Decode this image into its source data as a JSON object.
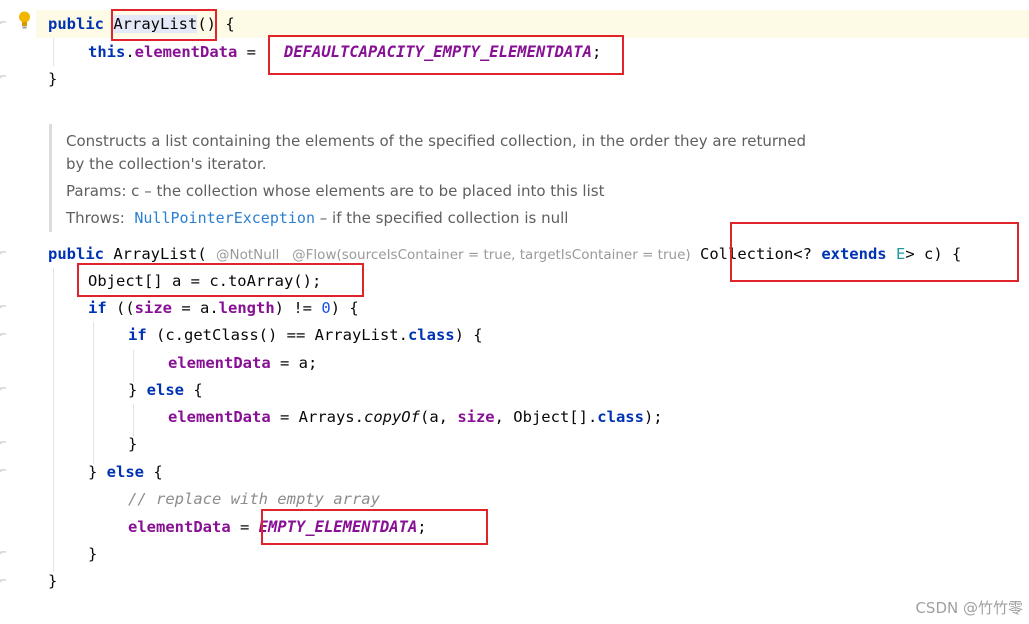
{
  "code": {
    "ctor1": {
      "kw_public": "public",
      "name": "ArrayList",
      "tail": "() {",
      "this_kw": "this",
      "dot": ".",
      "field": "elementData",
      "eq": " = ",
      "value": "DEFAULTCAPACITY_EMPTY_ELEMENTDATA",
      "semi": ";",
      "close": "}"
    },
    "doc": {
      "line1": "Constructs a list containing the elements of the specified collection, in the order they are returned",
      "line2": "by the collection's iterator.",
      "params_label": "Params:",
      "params_text": " c – the collection whose elements are to be placed into this list",
      "throws_label": "Throws:",
      "throws_type": "NullPointerException",
      "throws_text": " – if the specified collection is null"
    },
    "ctor2": {
      "kw_public": "public",
      "sig_open": " ArrayList( ",
      "annotations": "@NotNull   @Flow(sourceIsContainer = true, targetIsContainer = true)",
      "param_type": " Collection<? ",
      "kw_extends": "extends",
      "type_param": "E",
      "param_tail": "> c) {",
      "line_toarray": "Object[] a = c.toArray();",
      "kw_if": "if",
      "if_open": " ((",
      "field_size": "size",
      "if_mid": " = a.",
      "field_length": "length",
      "if_cmp": ") != ",
      "zero": "0",
      "if_close": ") {",
      "inner_if_open": " (c.getClass() == ArrayList.",
      "kw_class": "class",
      "inner_if_close": ") {",
      "field": "elementData",
      "assign_a": " = a;",
      "else_open": "} ",
      "kw_else": "else",
      "brace_open": " {",
      "assign_copy_start": " = Arrays.",
      "method_copyof": "copyOf",
      "copy_args_start": "(a, ",
      "copy_args_mid": ", Object[].",
      "copy_args_end": ");",
      "brace_close": "}",
      "comment": "// replace with empty array",
      "eq": " = ",
      "empty_const": "EMPTY_ELEMENTDATA",
      "semi": ";"
    }
  },
  "watermark": "CSDN @竹竹零",
  "colors": {
    "keyword": "#0033b3",
    "field": "#871094",
    "number": "#1750eb",
    "comment": "#8c8c8c",
    "annotation_box": "#e0242a"
  }
}
